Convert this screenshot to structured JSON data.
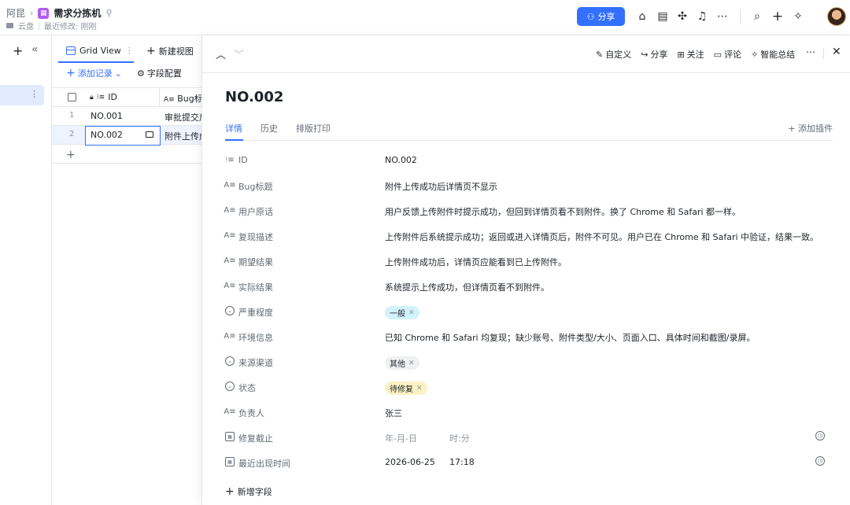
{
  "header": {
    "crumb_root": "阿昆",
    "app_title": "需求分拣机",
    "location": "云盘",
    "last_modified": "最近修改: 刚刚",
    "share_label": "分享",
    "colors": {
      "accent": "#3370ff",
      "app_icon": "#b05cf2"
    }
  },
  "grid": {
    "view_tab": "Grid View",
    "new_view": "新建视图",
    "add_record": "添加记录",
    "field_config": "字段配置",
    "col_id": "ID",
    "col_bug": "Bug标题",
    "rows": [
      {
        "num": "1",
        "id": "NO.001",
        "bug": "审批提交后"
      },
      {
        "num": "2",
        "id": "NO.002",
        "bug": "附件上传成功后"
      }
    ]
  },
  "panel": {
    "actions": {
      "customize": "自定义",
      "share": "分享",
      "follow": "关注",
      "comment": "评论",
      "summary": "智能总结"
    },
    "record_title": "NO.002",
    "tabs": {
      "detail": "详情",
      "history": "历史",
      "print": "排版打印",
      "add_plugin": "添加插件"
    },
    "fields": {
      "id": {
        "label": "ID",
        "value": "NO.002"
      },
      "bug_title": {
        "label": "Bug标题",
        "value": "附件上传成功后详情页不显示"
      },
      "user_words": {
        "label": "用户原话",
        "value": "用户反馈上传附件时提示成功，但回到详情页看不到附件。换了 Chrome 和 Safari 都一样。"
      },
      "repro": {
        "label": "复现描述",
        "value": "上传附件后系统提示成功；返回或进入详情页后，附件不可见。用户已在 Chrome 和 Safari 中验证，结果一致。"
      },
      "expected": {
        "label": "期望结果",
        "value": "上传附件成功后，详情页应能看到已上传附件。"
      },
      "actual": {
        "label": "实际结果",
        "value": "系统提示上传成功，但详情页看不到附件。"
      },
      "severity": {
        "label": "严重程度",
        "value": "一般",
        "color": "#d1f3fa"
      },
      "env": {
        "label": "环境信息",
        "value": "已知 Chrome 和 Safari 均复现；缺少账号、附件类型/大小、页面入口、具体时间和截图/录屏。"
      },
      "source": {
        "label": "来源渠道",
        "value": "其他",
        "color": "#eff0f1"
      },
      "status": {
        "label": "状态",
        "value": "待修复",
        "color": "#fbf2c5"
      },
      "owner": {
        "label": "负责人",
        "value": "张三"
      },
      "deadline": {
        "label": "修复截止",
        "date_placeholder": "年-月-日",
        "time_placeholder": "时:分"
      },
      "last_seen": {
        "label": "最近出现时间",
        "date": "2026-06-25",
        "time": "17:18"
      }
    },
    "add_field": "新增字段"
  }
}
